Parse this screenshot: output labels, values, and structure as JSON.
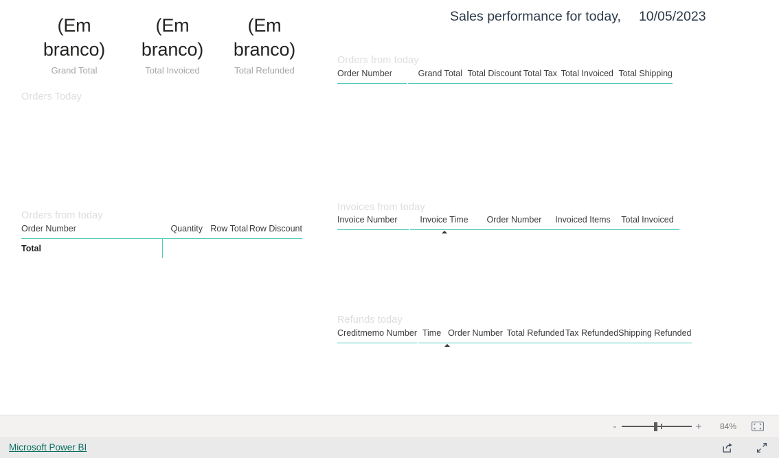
{
  "header": {
    "title": "Sales performance for today,",
    "date": "10/05/2023"
  },
  "kpis": [
    {
      "value": "(Em branco)",
      "label": "Grand Total"
    },
    {
      "value": "(Em branco)",
      "label": "Total Invoiced"
    },
    {
      "value": "(Em branco)",
      "label": "Total Refunded"
    }
  ],
  "visuals": {
    "orders_today_chart": {
      "title": "Orders Today"
    },
    "orders_from_today_right": {
      "title": "Orders from today",
      "columns": [
        "Order Number",
        "Grand Total",
        "Total Discount",
        "Total Tax",
        "Total Invoiced",
        "Total Shipping"
      ],
      "rows": []
    },
    "orders_from_today_left": {
      "title": "Orders from today",
      "columns": [
        "Order Number",
        "Quantity",
        "Row Total",
        "Row Discount"
      ],
      "rows": [],
      "total_label": "Total"
    },
    "invoices_from_today": {
      "title": "Invoices from today",
      "columns": [
        "Invoice Number",
        "Invoice Time",
        "Order Number",
        "Invoiced Items",
        "Total Invoiced"
      ],
      "sorted_column": "Invoice Time",
      "sort_direction": "ascending",
      "rows": []
    },
    "refunds_today": {
      "title": "Refunds today",
      "columns": [
        "Creditmemo Number",
        "Time",
        "Order Number",
        "Total Refunded",
        "Tax Refunded",
        "Shipping Refunded"
      ],
      "sorted_column": "Time",
      "sort_direction": "ascending",
      "rows": []
    }
  },
  "status_bar": {
    "zoom_out_label": "-",
    "zoom_in_label": "+",
    "zoom_percent": "84%",
    "fit_to_page_icon": "fit-to-page-icon"
  },
  "footer": {
    "brand_link": "Microsoft Power BI",
    "share_icon": "share-icon",
    "fullscreen_icon": "fullscreen-icon"
  },
  "colors": {
    "accent_teal": "#4ec9bd",
    "link_teal": "#0a6e61",
    "title_text": "#2a3a4a",
    "visual_title": "#dddddd",
    "kpi_label": "#a6a6a6"
  }
}
